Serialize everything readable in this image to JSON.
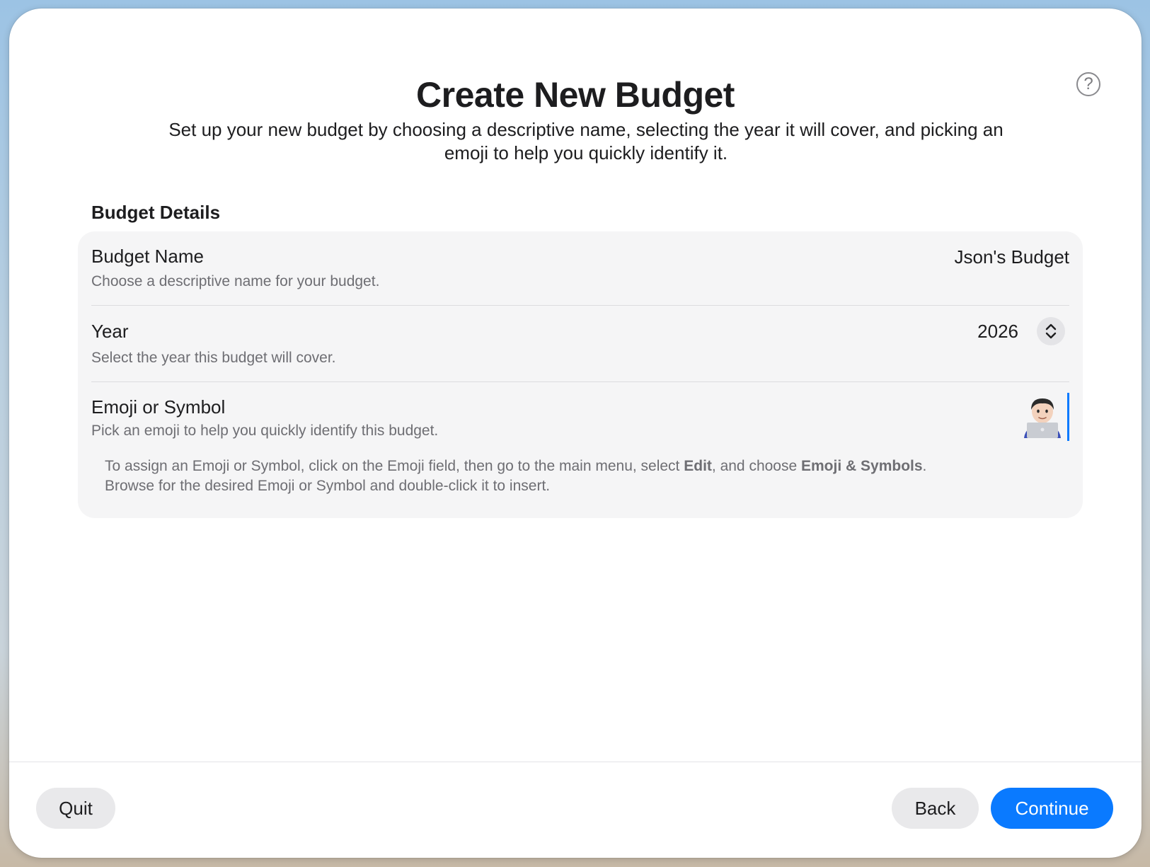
{
  "header": {
    "title": "Create New Budget",
    "subtitle": "Set up your new budget by choosing a descriptive name, selecting the year it will cover, and picking an emoji to help you quickly identify it."
  },
  "section": {
    "title": "Budget Details"
  },
  "fields": {
    "name": {
      "label": "Budget Name",
      "description": "Choose a descriptive name for your budget.",
      "value": "Json's Budget"
    },
    "year": {
      "label": "Year",
      "description": "Select the year this budget will cover.",
      "value": "2026"
    },
    "emoji": {
      "label": "Emoji or Symbol",
      "description": "Pick an emoji to help you quickly identify this budget.",
      "value_icon": "technologist-emoji"
    }
  },
  "instructions": {
    "part1": "To assign an Emoji or Symbol, click on the Emoji field, then go to the main menu, select ",
    "edit": "Edit",
    "part2": ", and choose ",
    "emoji_symbols": "Emoji & Symbols",
    "part3": ". Browse for the desired Emoji or Symbol and double-click it to insert."
  },
  "buttons": {
    "quit": "Quit",
    "back": "Back",
    "continue": "Continue"
  },
  "icons": {
    "help": "help-icon",
    "stepper": "chevron-up-down-icon"
  },
  "colors": {
    "accent": "#0a7aff",
    "card": "#f5f5f6",
    "secondary_text": "#6e6e73"
  }
}
